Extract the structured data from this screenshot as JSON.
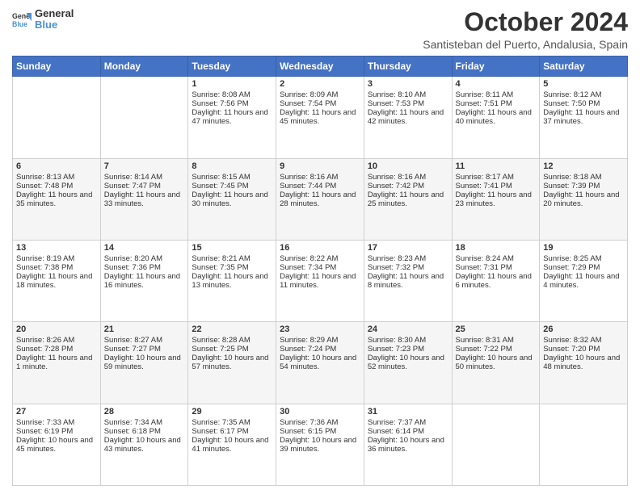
{
  "header": {
    "logo_line1": "General",
    "logo_line2": "Blue",
    "month_year": "October 2024",
    "location": "Santisteban del Puerto, Andalusia, Spain"
  },
  "days_of_week": [
    "Sunday",
    "Monday",
    "Tuesday",
    "Wednesday",
    "Thursday",
    "Friday",
    "Saturday"
  ],
  "weeks": [
    [
      {
        "day": "",
        "sunrise": "",
        "sunset": "",
        "daylight": ""
      },
      {
        "day": "",
        "sunrise": "",
        "sunset": "",
        "daylight": ""
      },
      {
        "day": "1",
        "sunrise": "Sunrise: 8:08 AM",
        "sunset": "Sunset: 7:56 PM",
        "daylight": "Daylight: 11 hours and 47 minutes."
      },
      {
        "day": "2",
        "sunrise": "Sunrise: 8:09 AM",
        "sunset": "Sunset: 7:54 PM",
        "daylight": "Daylight: 11 hours and 45 minutes."
      },
      {
        "day": "3",
        "sunrise": "Sunrise: 8:10 AM",
        "sunset": "Sunset: 7:53 PM",
        "daylight": "Daylight: 11 hours and 42 minutes."
      },
      {
        "day": "4",
        "sunrise": "Sunrise: 8:11 AM",
        "sunset": "Sunset: 7:51 PM",
        "daylight": "Daylight: 11 hours and 40 minutes."
      },
      {
        "day": "5",
        "sunrise": "Sunrise: 8:12 AM",
        "sunset": "Sunset: 7:50 PM",
        "daylight": "Daylight: 11 hours and 37 minutes."
      }
    ],
    [
      {
        "day": "6",
        "sunrise": "Sunrise: 8:13 AM",
        "sunset": "Sunset: 7:48 PM",
        "daylight": "Daylight: 11 hours and 35 minutes."
      },
      {
        "day": "7",
        "sunrise": "Sunrise: 8:14 AM",
        "sunset": "Sunset: 7:47 PM",
        "daylight": "Daylight: 11 hours and 33 minutes."
      },
      {
        "day": "8",
        "sunrise": "Sunrise: 8:15 AM",
        "sunset": "Sunset: 7:45 PM",
        "daylight": "Daylight: 11 hours and 30 minutes."
      },
      {
        "day": "9",
        "sunrise": "Sunrise: 8:16 AM",
        "sunset": "Sunset: 7:44 PM",
        "daylight": "Daylight: 11 hours and 28 minutes."
      },
      {
        "day": "10",
        "sunrise": "Sunrise: 8:16 AM",
        "sunset": "Sunset: 7:42 PM",
        "daylight": "Daylight: 11 hours and 25 minutes."
      },
      {
        "day": "11",
        "sunrise": "Sunrise: 8:17 AM",
        "sunset": "Sunset: 7:41 PM",
        "daylight": "Daylight: 11 hours and 23 minutes."
      },
      {
        "day": "12",
        "sunrise": "Sunrise: 8:18 AM",
        "sunset": "Sunset: 7:39 PM",
        "daylight": "Daylight: 11 hours and 20 minutes."
      }
    ],
    [
      {
        "day": "13",
        "sunrise": "Sunrise: 8:19 AM",
        "sunset": "Sunset: 7:38 PM",
        "daylight": "Daylight: 11 hours and 18 minutes."
      },
      {
        "day": "14",
        "sunrise": "Sunrise: 8:20 AM",
        "sunset": "Sunset: 7:36 PM",
        "daylight": "Daylight: 11 hours and 16 minutes."
      },
      {
        "day": "15",
        "sunrise": "Sunrise: 8:21 AM",
        "sunset": "Sunset: 7:35 PM",
        "daylight": "Daylight: 11 hours and 13 minutes."
      },
      {
        "day": "16",
        "sunrise": "Sunrise: 8:22 AM",
        "sunset": "Sunset: 7:34 PM",
        "daylight": "Daylight: 11 hours and 11 minutes."
      },
      {
        "day": "17",
        "sunrise": "Sunrise: 8:23 AM",
        "sunset": "Sunset: 7:32 PM",
        "daylight": "Daylight: 11 hours and 8 minutes."
      },
      {
        "day": "18",
        "sunrise": "Sunrise: 8:24 AM",
        "sunset": "Sunset: 7:31 PM",
        "daylight": "Daylight: 11 hours and 6 minutes."
      },
      {
        "day": "19",
        "sunrise": "Sunrise: 8:25 AM",
        "sunset": "Sunset: 7:29 PM",
        "daylight": "Daylight: 11 hours and 4 minutes."
      }
    ],
    [
      {
        "day": "20",
        "sunrise": "Sunrise: 8:26 AM",
        "sunset": "Sunset: 7:28 PM",
        "daylight": "Daylight: 11 hours and 1 minute."
      },
      {
        "day": "21",
        "sunrise": "Sunrise: 8:27 AM",
        "sunset": "Sunset: 7:27 PM",
        "daylight": "Daylight: 10 hours and 59 minutes."
      },
      {
        "day": "22",
        "sunrise": "Sunrise: 8:28 AM",
        "sunset": "Sunset: 7:25 PM",
        "daylight": "Daylight: 10 hours and 57 minutes."
      },
      {
        "day": "23",
        "sunrise": "Sunrise: 8:29 AM",
        "sunset": "Sunset: 7:24 PM",
        "daylight": "Daylight: 10 hours and 54 minutes."
      },
      {
        "day": "24",
        "sunrise": "Sunrise: 8:30 AM",
        "sunset": "Sunset: 7:23 PM",
        "daylight": "Daylight: 10 hours and 52 minutes."
      },
      {
        "day": "25",
        "sunrise": "Sunrise: 8:31 AM",
        "sunset": "Sunset: 7:22 PM",
        "daylight": "Daylight: 10 hours and 50 minutes."
      },
      {
        "day": "26",
        "sunrise": "Sunrise: 8:32 AM",
        "sunset": "Sunset: 7:20 PM",
        "daylight": "Daylight: 10 hours and 48 minutes."
      }
    ],
    [
      {
        "day": "27",
        "sunrise": "Sunrise: 7:33 AM",
        "sunset": "Sunset: 6:19 PM",
        "daylight": "Daylight: 10 hours and 45 minutes."
      },
      {
        "day": "28",
        "sunrise": "Sunrise: 7:34 AM",
        "sunset": "Sunset: 6:18 PM",
        "daylight": "Daylight: 10 hours and 43 minutes."
      },
      {
        "day": "29",
        "sunrise": "Sunrise: 7:35 AM",
        "sunset": "Sunset: 6:17 PM",
        "daylight": "Daylight: 10 hours and 41 minutes."
      },
      {
        "day": "30",
        "sunrise": "Sunrise: 7:36 AM",
        "sunset": "Sunset: 6:15 PM",
        "daylight": "Daylight: 10 hours and 39 minutes."
      },
      {
        "day": "31",
        "sunrise": "Sunrise: 7:37 AM",
        "sunset": "Sunset: 6:14 PM",
        "daylight": "Daylight: 10 hours and 36 minutes."
      },
      {
        "day": "",
        "sunrise": "",
        "sunset": "",
        "daylight": ""
      },
      {
        "day": "",
        "sunrise": "",
        "sunset": "",
        "daylight": ""
      }
    ]
  ]
}
